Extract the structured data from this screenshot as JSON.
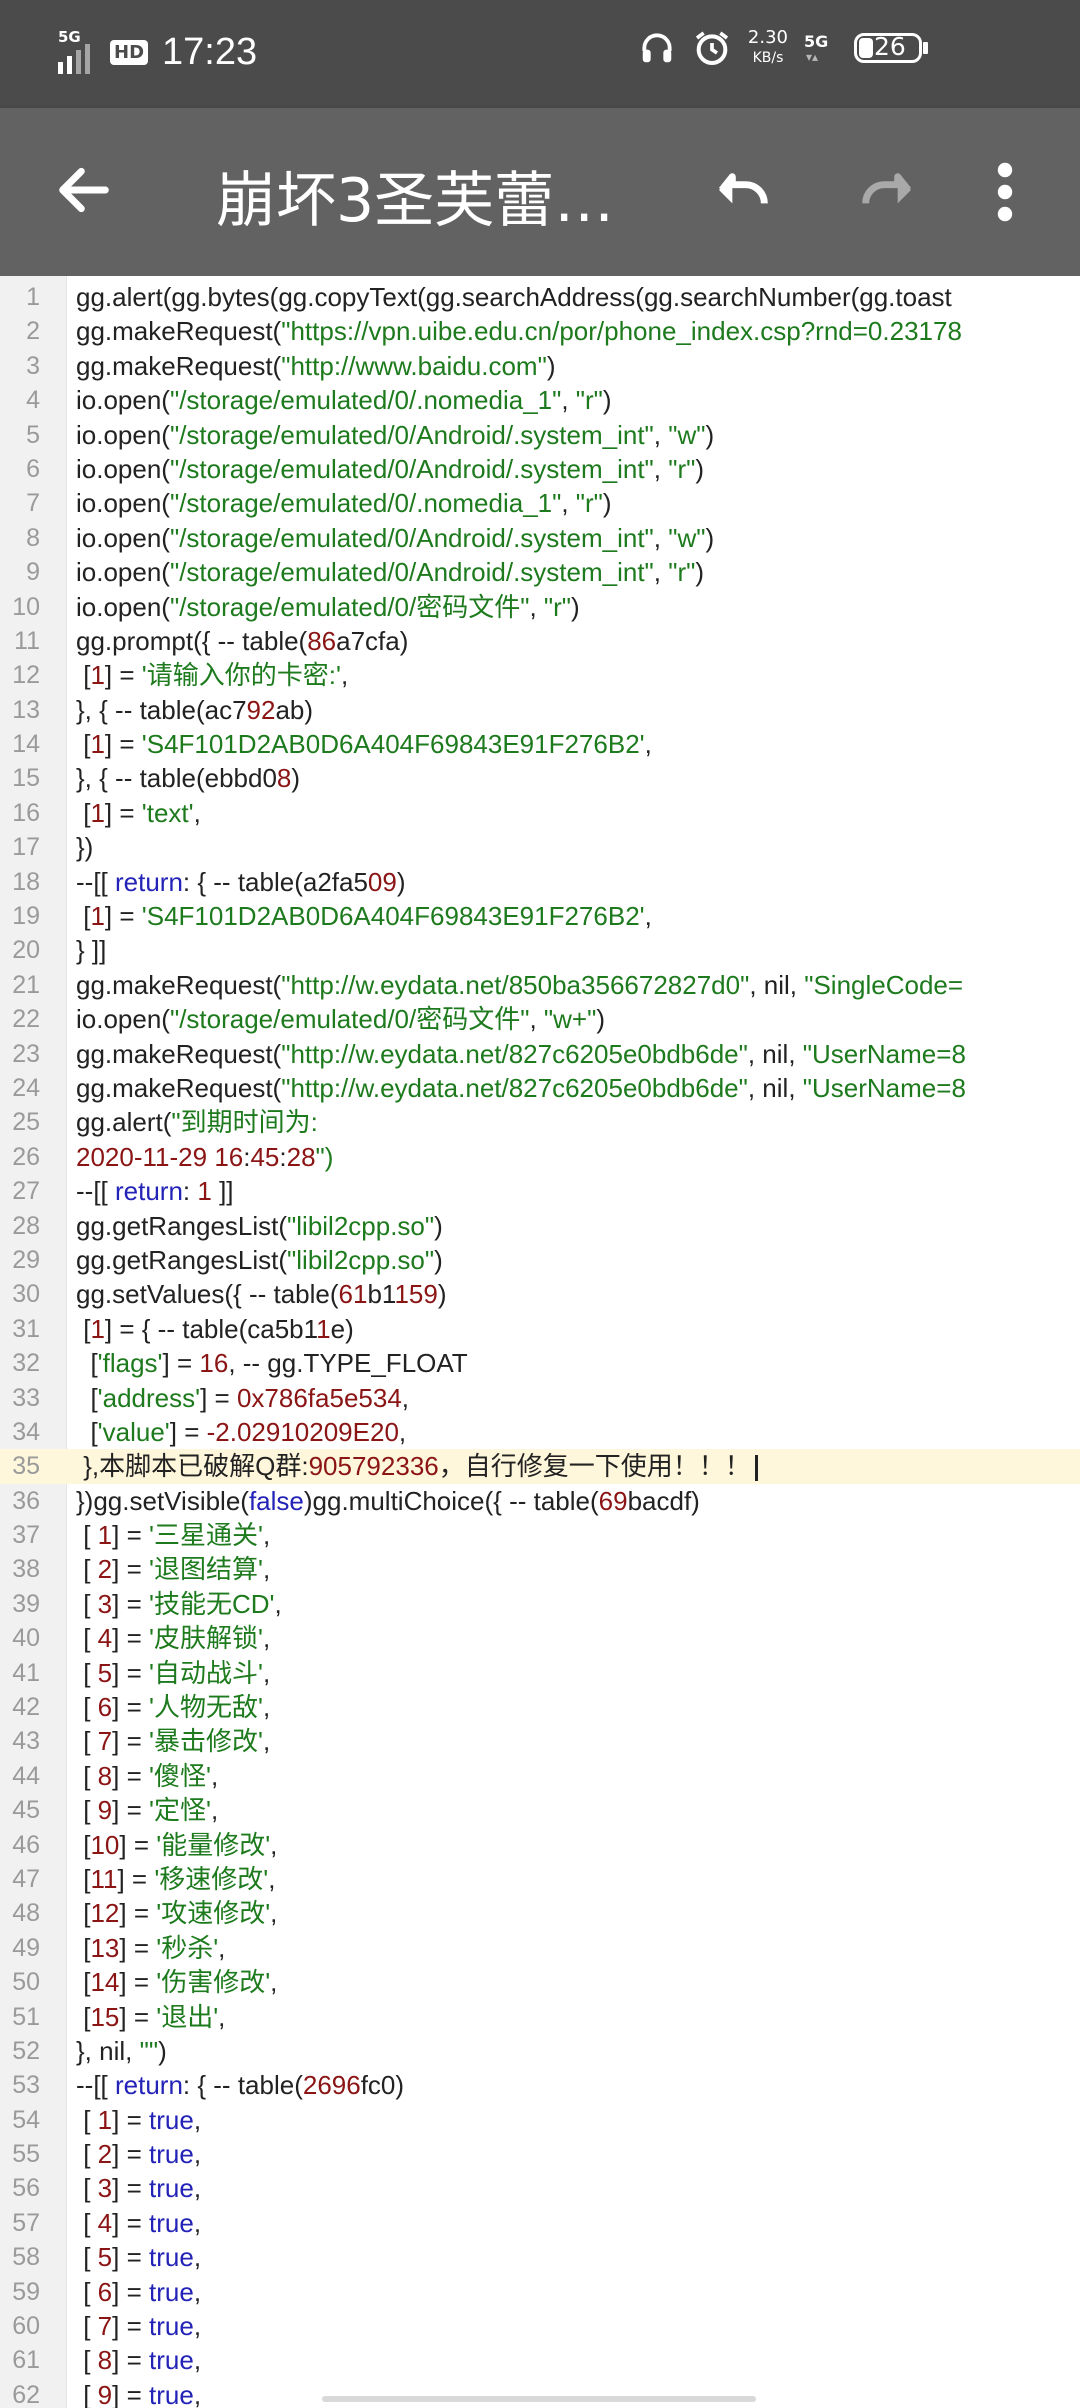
{
  "status_bar": {
    "network_left": "5G",
    "hd_badge": "HD",
    "time": "17:23",
    "speed_value": "2.30",
    "speed_unit": "KB/s",
    "network_right": "5G",
    "battery": "26"
  },
  "toolbar": {
    "title": "崩坏3圣芙蕾…",
    "back_icon": "arrow-back-icon",
    "undo_icon": "undo-icon",
    "redo_icon": "redo-icon",
    "more_icon": "more-vertical-icon"
  },
  "editor": {
    "active_line": 35,
    "lines": [
      {
        "n": "1",
        "t": "gg.alert(gg.bytes(gg.copyText(gg.searchAddress(gg.searchNumber(gg.toast"
      },
      {
        "n": "2",
        "t": "gg.makeRequest(\"https://vpn.uibe.edu.cn/por/phone_index.csp?rnd=0.23178"
      },
      {
        "n": "3",
        "t": "gg.makeRequest(\"http://www.baidu.com\")"
      },
      {
        "n": "4",
        "t": "io.open(\"/storage/emulated/0/.nomedia_1\", \"r\")"
      },
      {
        "n": "5",
        "t": "io.open(\"/storage/emulated/0/Android/.system_int\", \"w\")"
      },
      {
        "n": "6",
        "t": "io.open(\"/storage/emulated/0/Android/.system_int\", \"r\")"
      },
      {
        "n": "7",
        "t": "io.open(\"/storage/emulated/0/.nomedia_1\", \"r\")"
      },
      {
        "n": "8",
        "t": "io.open(\"/storage/emulated/0/Android/.system_int\", \"w\")"
      },
      {
        "n": "9",
        "t": "io.open(\"/storage/emulated/0/Android/.system_int\", \"r\")"
      },
      {
        "n": "10",
        "t": "io.open(\"/storage/emulated/0/密码文件\", \"r\")"
      },
      {
        "n": "11",
        "t": "gg.prompt({ -- table(86a7cfa)"
      },
      {
        "n": "12",
        "t": " [1] = '请输入你的卡密:',"
      },
      {
        "n": "13",
        "t": "}, { -- table(ac792ab)"
      },
      {
        "n": "14",
        "t": " [1] = 'S4F101D2AB0D6A404F69843E91F276B2',"
      },
      {
        "n": "15",
        "t": "}, { -- table(ebbd08)"
      },
      {
        "n": "16",
        "t": " [1] = 'text',"
      },
      {
        "n": "17",
        "t": "})"
      },
      {
        "n": "18",
        "t": "--[[ return: { -- table(a2fa509)"
      },
      {
        "n": "19",
        "t": " [1] = 'S4F101D2AB0D6A404F69843E91F276B2',"
      },
      {
        "n": "20",
        "t": "} ]]"
      },
      {
        "n": "21",
        "t": "gg.makeRequest(\"http://w.eydata.net/850ba356672827d0\", nil, \"SingleCode="
      },
      {
        "n": "22",
        "t": "io.open(\"/storage/emulated/0/密码文件\", \"w+\")"
      },
      {
        "n": "23",
        "t": "gg.makeRequest(\"http://w.eydata.net/827c6205e0bdb6de\", nil, \"UserName=8"
      },
      {
        "n": "24",
        "t": "gg.makeRequest(\"http://w.eydata.net/827c6205e0bdb6de\", nil, \"UserName=8"
      },
      {
        "n": "25",
        "t": "gg.alert(\"到期时间为:"
      },
      {
        "n": "26",
        "t": "2020-11-29 16:45:28\")"
      },
      {
        "n": "27",
        "t": "--[[ return: 1 ]]"
      },
      {
        "n": "28",
        "t": "gg.getRangesList(\"libil2cpp.so\")"
      },
      {
        "n": "29",
        "t": "gg.getRangesList(\"libil2cpp.so\")"
      },
      {
        "n": "30",
        "t": "gg.setValues({ -- table(61b1159)"
      },
      {
        "n": "31",
        "t": " [1] = { -- table(ca5b11e)"
      },
      {
        "n": "32",
        "t": "  ['flags'] = 16, -- gg.TYPE_FLOAT"
      },
      {
        "n": "33",
        "t": "  ['address'] = 0x786fa5e534,"
      },
      {
        "n": "34",
        "t": "  ['value'] = -2.02910209E20,"
      },
      {
        "n": "35",
        "t": " },本脚本已破解Q群:905792336，自行修复一下使用！！！"
      },
      {
        "n": "36",
        "t": "})gg.setVisible(false)gg.multiChoice({ -- table(69bacdf)"
      },
      {
        "n": "37",
        "t": " [ 1] = '三星通关',"
      },
      {
        "n": "38",
        "t": " [ 2] = '退图结算',"
      },
      {
        "n": "39",
        "t": " [ 3] = '技能无CD',"
      },
      {
        "n": "40",
        "t": " [ 4] = '皮肤解锁',"
      },
      {
        "n": "41",
        "t": " [ 5] = '自动战斗',"
      },
      {
        "n": "42",
        "t": " [ 6] = '人物无敌',"
      },
      {
        "n": "43",
        "t": " [ 7] = '暴击修改',"
      },
      {
        "n": "44",
        "t": " [ 8] = '傻怪',"
      },
      {
        "n": "45",
        "t": " [ 9] = '定怪',"
      },
      {
        "n": "46",
        "t": " [10] = '能量修改',"
      },
      {
        "n": "47",
        "t": " [11] = '移速修改',"
      },
      {
        "n": "48",
        "t": " [12] = '攻速修改',"
      },
      {
        "n": "49",
        "t": " [13] = '秒杀',"
      },
      {
        "n": "50",
        "t": " [14] = '伤害修改',"
      },
      {
        "n": "51",
        "t": " [15] = '退出',"
      },
      {
        "n": "52",
        "t": "}, nil, \"\")"
      },
      {
        "n": "53",
        "t": "--[[ return: { -- table(2696fc0)"
      },
      {
        "n": "54",
        "t": " [ 1] = true,"
      },
      {
        "n": "55",
        "t": " [ 2] = true,"
      },
      {
        "n": "56",
        "t": " [ 3] = true,"
      },
      {
        "n": "57",
        "t": " [ 4] = true,"
      },
      {
        "n": "58",
        "t": " [ 5] = true,"
      },
      {
        "n": "59",
        "t": " [ 6] = true,"
      },
      {
        "n": "60",
        "t": " [ 7] = true,"
      },
      {
        "n": "61",
        "t": " [ 8] = true,"
      },
      {
        "n": "62",
        "t": " [ 9] = true,"
      }
    ]
  }
}
